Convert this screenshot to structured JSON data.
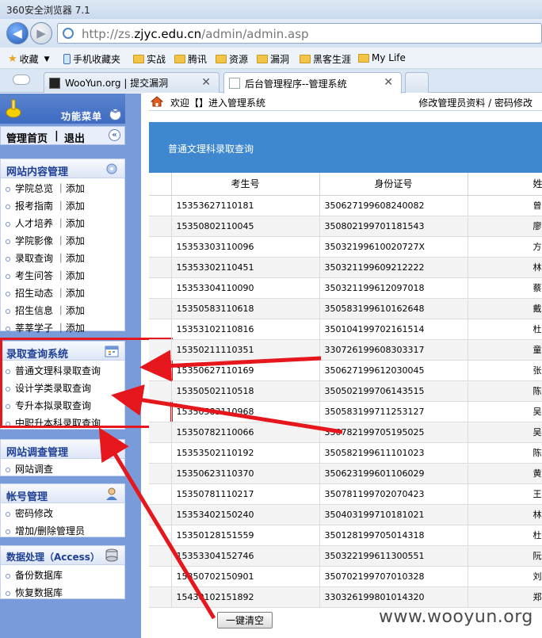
{
  "browser": {
    "title": "360安全浏览器 7.1",
    "url_prefix": "http://zs.",
    "url_host": "zjyc.edu.cn",
    "url_path": "/admin/admin.asp",
    "bookmarks": [
      {
        "label": "收藏",
        "icon": "star-icon"
      },
      {
        "label": "手机收藏夹",
        "icon": "phone-icon"
      },
      {
        "label": "实战",
        "icon": "folder-icon"
      },
      {
        "label": "腾讯",
        "icon": "folder-icon"
      },
      {
        "label": "资源",
        "icon": "folder-icon"
      },
      {
        "label": "漏洞",
        "icon": "folder-icon"
      },
      {
        "label": "黑客生涯",
        "icon": "folder-icon"
      },
      {
        "label": "My Life",
        "icon": "folder-icon"
      }
    ],
    "tabs": [
      {
        "label": "WooYun.org | 提交漏洞"
      },
      {
        "label": "后台管理程序--管理系统"
      }
    ]
  },
  "sidebar": {
    "header_title": "功能菜单",
    "home_label": "管理首页",
    "logout_label": "退出",
    "sections": [
      {
        "title": "网站内容管理",
        "items": [
          "学院总览 ｜添加",
          "报考指南 ｜添加",
          "人才培养 ｜添加",
          "学院影像 ｜添加",
          "录取查询 ｜添加",
          "考生问答 ｜添加",
          "招生动态 ｜添加",
          "招生信息 ｜添加",
          "莘莘学子 ｜添加"
        ]
      },
      {
        "title": "录取查询系统",
        "items": [
          "普通文理科录取查询",
          "设计学类录取查询",
          "专升本拟录取查询",
          "中职升本科录取查询"
        ]
      },
      {
        "title": "网站调查管理",
        "items": [
          "网站调查"
        ]
      },
      {
        "title": "帐号管理",
        "items": [
          "密码修改",
          "增加/删除管理员"
        ]
      },
      {
        "title": "数据处理（Access）",
        "items": [
          "备份数据库",
          "恢复数据库"
        ]
      }
    ]
  },
  "content": {
    "welcome": "欢迎【】进入管理系统",
    "top_links": "修改管理员资料 / 密码修改",
    "panel_title": "普通文理科录取查询",
    "columns": [
      "考生号",
      "身份证号",
      "姓"
    ],
    "rows": [
      [
        "15353627110181",
        "350627199608240082",
        "曾"
      ],
      [
        "15350802110045",
        "350802199701181543",
        "廖"
      ],
      [
        "15353303110096",
        "35032199610020727X",
        "方"
      ],
      [
        "15353302110451",
        "350321199609212222",
        "林"
      ],
      [
        "15353304110090",
        "350321199612097018",
        "蔡"
      ],
      [
        "15350583110618",
        "350583199610162648",
        "戴"
      ],
      [
        "15353102110816",
        "350104199702161514",
        "杜"
      ],
      [
        "15350211110351",
        "330726199608303317",
        "童"
      ],
      [
        "15350627110169",
        "350627199612030045",
        "张"
      ],
      [
        "15350502110518",
        "350502199706143515",
        "陈"
      ],
      [
        "15350583110968",
        "350583199711253127",
        "吴"
      ],
      [
        "15350782110066",
        "350782199705195025",
        "吴"
      ],
      [
        "15353502110192",
        "350582199611101023",
        "陈"
      ],
      [
        "15350623110370",
        "350623199601106029",
        "黄"
      ],
      [
        "15350781110217",
        "350781199702070423",
        "王"
      ],
      [
        "15353402150240",
        "350403199710181021",
        "林"
      ],
      [
        "15350128151559",
        "350128199705014318",
        "杜"
      ],
      [
        "15353304152746",
        "350322199611300551",
        "阮"
      ],
      [
        "15350702150901",
        "350702199707010328",
        "刘"
      ],
      [
        "15430102151892",
        "330326199801014320",
        "郑"
      ]
    ],
    "clear_button": "一键清空"
  },
  "watermark": "www.wooyun.org",
  "colors": {
    "annotation_red": "#e5161c",
    "panel_blue": "#3f88d0",
    "sidebar_blue": "#7a9bd9"
  }
}
